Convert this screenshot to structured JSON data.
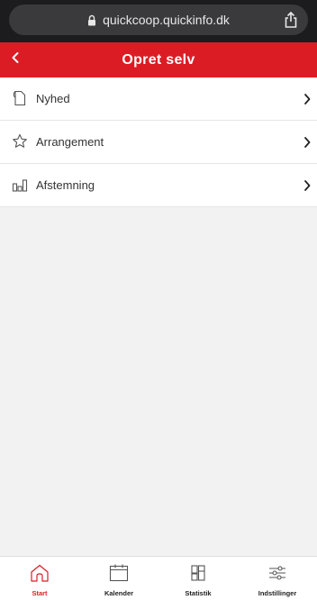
{
  "browser": {
    "url": "quickcoop.quickinfo.dk",
    "lock_icon": "lock-icon",
    "share_icon": "share-icon"
  },
  "header": {
    "title": "Opret selv",
    "back_icon": "chevron-left-icon",
    "color": "#dc1c24"
  },
  "menu": {
    "items": [
      {
        "label": "Nyhed",
        "icon": "document-icon"
      },
      {
        "label": "Arrangement",
        "icon": "star-icon"
      },
      {
        "label": "Afstemning",
        "icon": "bar-chart-icon"
      }
    ]
  },
  "tabbar": {
    "tabs": [
      {
        "label": "Start",
        "icon": "home-icon",
        "active": true
      },
      {
        "label": "Kalender",
        "icon": "calendar-icon",
        "active": false
      },
      {
        "label": "Statistik",
        "icon": "statistics-icon",
        "active": false
      },
      {
        "label": "Indstillinger",
        "icon": "sliders-icon",
        "active": false
      }
    ],
    "active_color": "#dc1c24"
  }
}
